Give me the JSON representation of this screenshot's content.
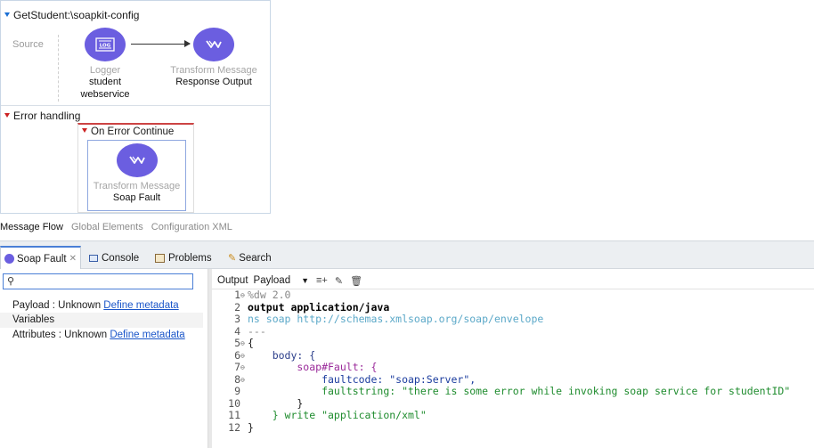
{
  "flow": {
    "title": "GetStudent:\\soapkit-config",
    "source_label": "Source",
    "logger": {
      "type": "Logger",
      "name_line1": "student",
      "name_line2": "webservice",
      "icon": "logger-icon"
    },
    "transform1": {
      "type": "Transform Message",
      "name": "Response Output",
      "icon": "transform-icon"
    },
    "error_handling": {
      "title": "Error handling",
      "on_error": {
        "title": "On Error Continue",
        "transform": {
          "type": "Transform Message",
          "name": "Soap Fault",
          "icon": "transform-icon"
        }
      }
    }
  },
  "editor_tabs": [
    {
      "label": "Message Flow",
      "active": true
    },
    {
      "label": "Global Elements",
      "active": false
    },
    {
      "label": "Configuration XML",
      "active": false
    }
  ],
  "panel_tabs": [
    {
      "label": "Soap Fault",
      "icon": "soap-fault-icon",
      "active": true,
      "closable": true
    },
    {
      "label": "Console",
      "icon": "console-icon",
      "active": false
    },
    {
      "label": "Problems",
      "icon": "problems-icon",
      "active": false
    },
    {
      "label": "Search",
      "icon": "search-icon",
      "active": false
    }
  ],
  "metadata": {
    "search_value": "",
    "rows": [
      {
        "label": "Payload : Unknown",
        "link": "Define metadata"
      },
      {
        "label": "Variables",
        "link": ""
      },
      {
        "label": "Attributes : Unknown",
        "link": "Define metadata"
      }
    ]
  },
  "output": {
    "label": "Output",
    "target": "Payload",
    "code": [
      {
        "n": "1",
        "fold": "⊖",
        "text": "%dw 2.0"
      },
      {
        "n": "2",
        "fold": "",
        "text": "output application/java"
      },
      {
        "n": "3",
        "fold": "",
        "text": "ns soap http://schemas.xmlsoap.org/soap/envelope"
      },
      {
        "n": "4",
        "fold": "",
        "text": "---"
      },
      {
        "n": "5",
        "fold": "⊖",
        "text": "{"
      },
      {
        "n": "6",
        "fold": "⊖",
        "text": "    body: {"
      },
      {
        "n": "7",
        "fold": "⊖",
        "text": "        soap#Fault: {"
      },
      {
        "n": "8",
        "fold": "⊖",
        "text": "            faultcode: \"soap:Server\","
      },
      {
        "n": "9",
        "fold": "",
        "text": "            faultstring: \"there is some error while invoking soap service for studentID\""
      },
      {
        "n": "10",
        "fold": "",
        "text": "        }"
      },
      {
        "n": "11",
        "fold": "",
        "text": "    } write \"application/xml\""
      },
      {
        "n": "12",
        "fold": "",
        "text": "}"
      }
    ]
  },
  "colors": {
    "component": "#6b5ee0",
    "accent": "#4a7fd6",
    "link": "#1b56c9",
    "error": "#cc3333"
  }
}
